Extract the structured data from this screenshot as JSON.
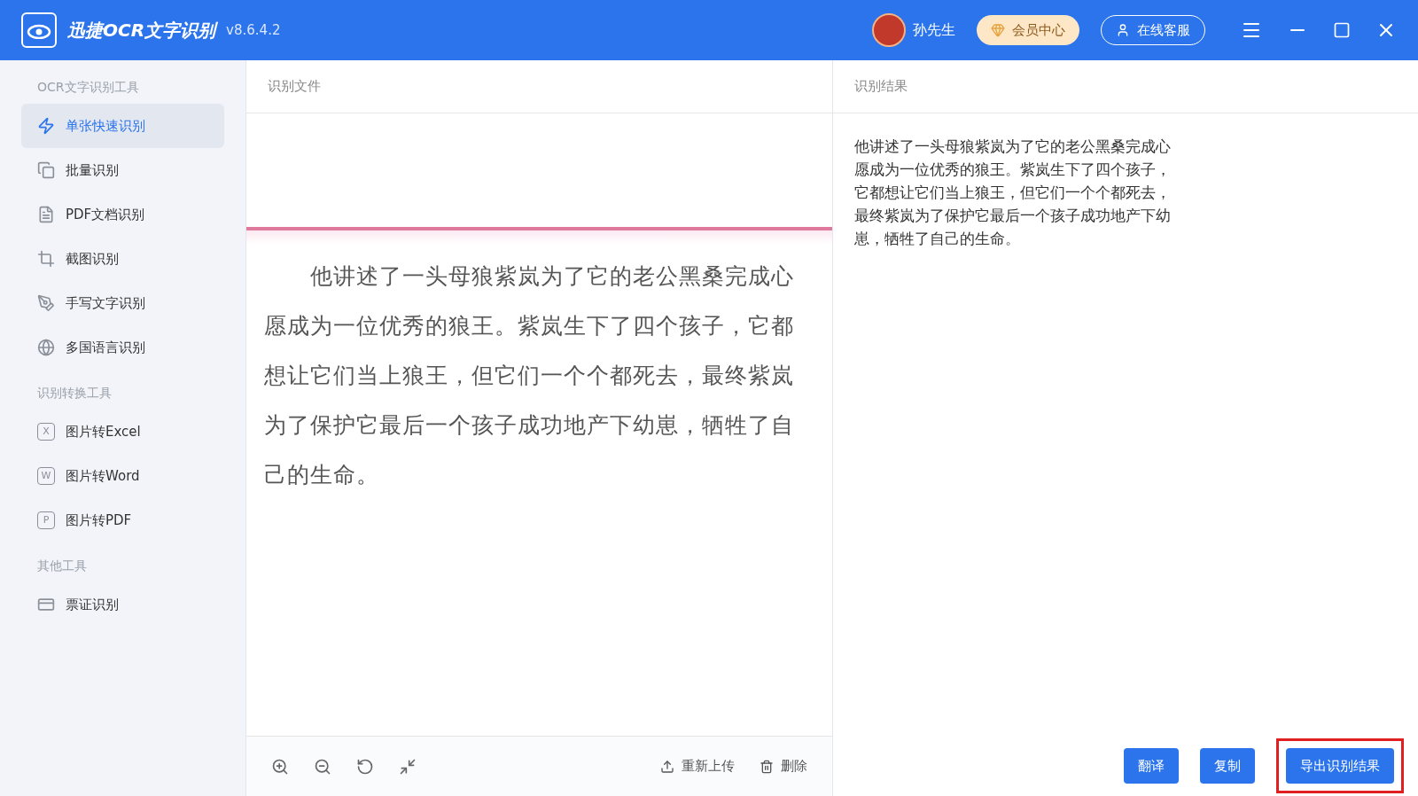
{
  "app": {
    "title": "迅捷OCR文字识别",
    "version": "v8.6.4.2",
    "user": "孙先生",
    "vip_button": "会员中心",
    "service_button": "在线客服"
  },
  "sidebar": {
    "sections": [
      {
        "title": "OCR文字识别工具",
        "items": [
          {
            "label": "单张快速识别",
            "selected": true
          },
          {
            "label": "批量识别",
            "selected": false
          },
          {
            "label": "PDF文档识别",
            "selected": false
          },
          {
            "label": "截图识别",
            "selected": false
          },
          {
            "label": "手写文字识别",
            "selected": false
          },
          {
            "label": "多国语言识别",
            "selected": false
          }
        ]
      },
      {
        "title": "识别转换工具",
        "items": [
          {
            "label": "图片转Excel",
            "glyph": "X",
            "selected": false
          },
          {
            "label": "图片转Word",
            "glyph": "W",
            "selected": false
          },
          {
            "label": "图片转PDF",
            "glyph": "P",
            "selected": false
          }
        ]
      },
      {
        "title": "其他工具",
        "items": [
          {
            "label": "票证识别",
            "selected": false
          }
        ]
      }
    ]
  },
  "source_panel": {
    "title": "识别文件",
    "image_text": "他讲述了一头母狼紫岚为了它的老公黑桑完成心愿成为一位优秀的狼王。紫岚生下了四个孩子，它都想让它们当上狼王，但它们一个个都死去，最终紫岚为了保护它最后一个孩子成功地产下幼崽，牺牲了自己的生命。",
    "toolbar": [
      {
        "kind": "icon"
      },
      {
        "kind": "icon"
      },
      {
        "kind": "icon"
      },
      {
        "kind": "icon"
      },
      {
        "kind": "text",
        "label": "重新上传"
      },
      {
        "kind": "text",
        "label": "删除"
      }
    ]
  },
  "result_panel": {
    "title": "识别结果",
    "text": "他讲述了一头母狼紫岚为了它的老公黑桑完成心愿成为一位优秀的狼王。紫岚生下了四个孩子，它都想让它们当上狼王，但它们一个个都死去，最终紫岚为了保护它最后一个孩子成功地产下幼崽，牺牲了自己的生命。",
    "buttons": [
      {
        "label": "翻译",
        "highlighted": false
      },
      {
        "label": "复制",
        "highlighted": false
      },
      {
        "label": "导出识别结果",
        "highlighted": true
      }
    ]
  }
}
